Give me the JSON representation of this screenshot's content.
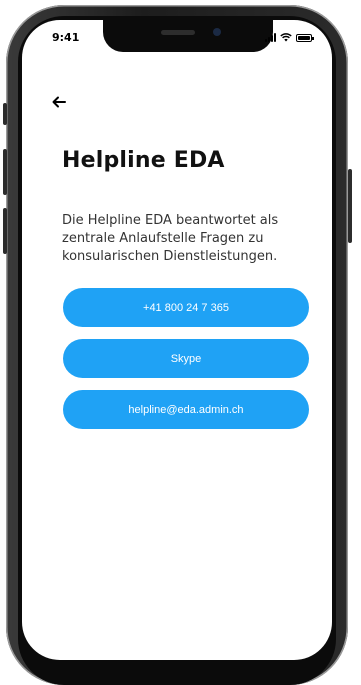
{
  "status_bar": {
    "time": "9:41"
  },
  "header": {
    "back_icon": "arrow-left-icon"
  },
  "page": {
    "title": "Helpline EDA",
    "description": "Die Helpline EDA beantwortet als zentrale Anlaufstelle Fragen zu konsularischen Dienstleistungen."
  },
  "actions": {
    "phone_label": "+41 800 24 7 365",
    "skype_label": "Skype",
    "email_label": "helpline@eda.admin.ch"
  },
  "colors": {
    "accent": "#1fa2f5",
    "title": "#111111",
    "text": "#333333"
  }
}
